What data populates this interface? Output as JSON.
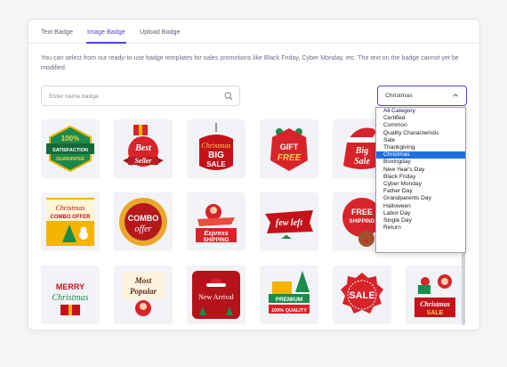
{
  "tabs": [
    {
      "label": "Text Badge",
      "active": false
    },
    {
      "label": "Image Badge",
      "active": true
    },
    {
      "label": "Upload Badge",
      "active": false
    }
  ],
  "description": "You can select from our ready-to-use badge templates for sales promotions like Black Friday, Cyber Monday, etc. The text on the badge cannot yet be modified.",
  "search": {
    "placeholder": "Enter name badge",
    "value": "",
    "icon": "search-icon"
  },
  "category_select": {
    "value": "Christmas",
    "open": true,
    "options": [
      "All Category",
      "Certified",
      "Common",
      "Quality Characteristic",
      "Sale",
      "Thankgiving",
      "Christmas",
      "Boxingday",
      "New Year's Day",
      "Black Friday",
      "Cyber Monday",
      "Father Day",
      "Grandparents Day",
      "Halloween",
      "Labor Day",
      "Single Day",
      "Return"
    ],
    "selected_option": "Christmas"
  },
  "badges": [
    {
      "name": "satisfaction-guarantee",
      "lines": [
        "100%",
        "SATISFACTION",
        "GUARANTEE"
      ]
    },
    {
      "name": "best-seller",
      "lines": [
        "Best",
        "Seller"
      ]
    },
    {
      "name": "christmas-big-sale",
      "lines": [
        "Christmas",
        "BIG",
        "SALE"
      ]
    },
    {
      "name": "gift-free",
      "lines": [
        "GIFT",
        "FREE"
      ]
    },
    {
      "name": "big-sale",
      "lines": [
        "Big",
        "Sale"
      ]
    },
    {
      "name": "christmas-combo-offer",
      "lines": [
        "Christmas",
        "COMBO OFFER"
      ]
    },
    {
      "name": "combo-offer",
      "lines": [
        "COMBO",
        "offer"
      ]
    },
    {
      "name": "express-shipping",
      "lines": [
        "Express",
        "SHIPPING"
      ]
    },
    {
      "name": "few-left",
      "lines": [
        "few left"
      ]
    },
    {
      "name": "free-shipping",
      "lines": [
        "FREE",
        "SHIPPING"
      ]
    },
    {
      "name": "merry-christmas",
      "lines": [
        "MERRY",
        "Christmas"
      ]
    },
    {
      "name": "most-popular",
      "lines": [
        "Most",
        "Popular"
      ]
    },
    {
      "name": "new-arrival",
      "lines": [
        "New Arrival"
      ]
    },
    {
      "name": "premium-quality",
      "lines": [
        "PREMIUM",
        "100% QUALITY"
      ]
    },
    {
      "name": "sale",
      "lines": [
        "SALE"
      ]
    },
    {
      "name": "christmas-sale",
      "lines": [
        "Christmas",
        "SALE"
      ]
    }
  ],
  "colors": {
    "accent": "#4e46dc",
    "red": "#d8232a",
    "green": "#1c8a4a",
    "gold": "#f4b400"
  }
}
